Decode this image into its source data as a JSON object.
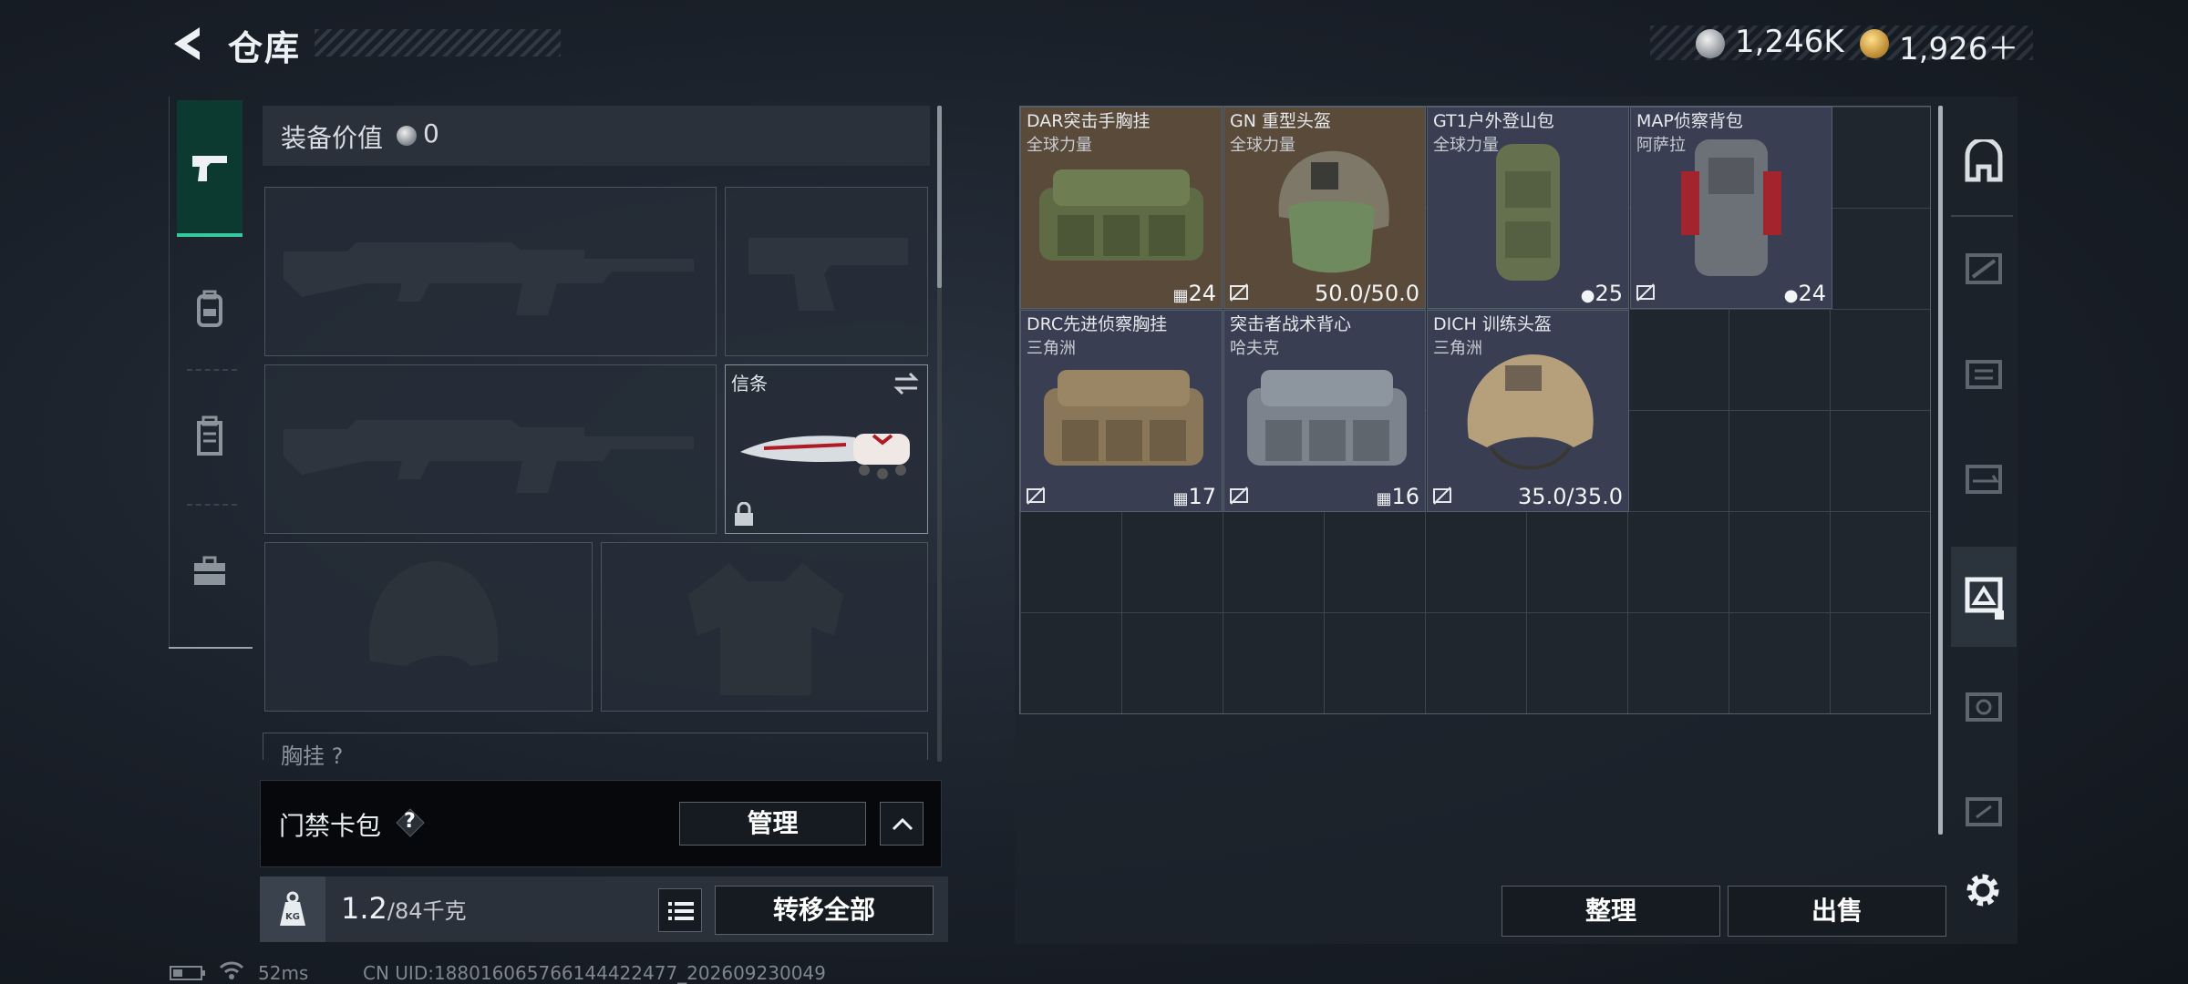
{
  "header": {
    "title": "仓库",
    "currency": [
      {
        "value": "1,246K",
        "icon": "silver-coin-icon",
        "color": "#9aa0a6"
      },
      {
        "value": "1,926＋",
        "icon": "gold-coin-icon",
        "color": "#d4a23c"
      }
    ]
  },
  "left_panel": {
    "equipment_value_label": "装备价值",
    "equipment_value": "0",
    "melee_slot_label": "信条",
    "next_section_label": "胸挂 ?",
    "access_card": {
      "label": "门禁卡包",
      "help": "?",
      "manage_label": "管理"
    },
    "weight": {
      "current": "1.2",
      "max": "/84千克"
    },
    "transfer_all_label": "转移全部"
  },
  "container": {
    "items": [
      {
        "name": "DAR突击手胸挂",
        "source": "全球力量",
        "stat": "24",
        "bg": "#5a4a3a"
      },
      {
        "name": "GN 重型头盔",
        "source": "全球力量",
        "stat": "50.0/50.0",
        "bg": "#5a4a3a"
      },
      {
        "name": "GT1户外登山包",
        "source": "全球力量",
        "stat": "25",
        "bg": "#3a3e52"
      },
      {
        "name": "MAP侦察背包",
        "source": "阿萨拉",
        "stat": "24",
        "bg": "#3a3e52"
      },
      {
        "name": "DRC先进侦察胸挂",
        "source": "三角洲",
        "stat": "17",
        "bg": "#3a3e52"
      },
      {
        "name": "突击者战术背心",
        "source": "哈夫克",
        "stat": "16",
        "bg": "#3a3e52"
      },
      {
        "name": "DICH 训练头盔",
        "source": "三角洲",
        "stat": "35.0/35.0",
        "bg": "#3a3e52"
      }
    ],
    "sort_label": "整理",
    "sell_label": "出售"
  },
  "status_bar": {
    "ping": "52ms",
    "uid": "CN UID:18801606576614442247​7_202609230049"
  },
  "colors": {
    "accent": "#36c9a0",
    "active_tab_bg": "#0c3a30"
  }
}
